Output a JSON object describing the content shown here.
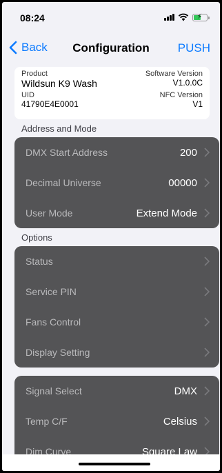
{
  "status_bar": {
    "time": "08:24"
  },
  "nav": {
    "back_label": "Back",
    "title": "Configuration",
    "push_label": "PUSH"
  },
  "info": {
    "product_label": "Product",
    "product_value": "Wildsun K9 Wash",
    "software_label": "Software Version",
    "software_value": "V1.0.0C",
    "uid_label": "UID",
    "uid_value": "41790E4E0001",
    "nfc_label": "NFC Version",
    "nfc_value": "V1"
  },
  "address_section": {
    "header": "Address and Mode",
    "rows": [
      {
        "label": "DMX Start Address",
        "value": "200"
      },
      {
        "label": "Decimal Universe",
        "value": "00000"
      },
      {
        "label": "User Mode",
        "value": "Extend Mode"
      }
    ]
  },
  "options_section": {
    "header": "Options",
    "rows": [
      {
        "label": "Status"
      },
      {
        "label": "Service PIN"
      },
      {
        "label": "Fans Control"
      },
      {
        "label": "Display Setting"
      }
    ]
  },
  "settings_section": {
    "rows": [
      {
        "label": "Signal Select",
        "value": "DMX"
      },
      {
        "label": "Temp C/F",
        "value": "Celsius"
      },
      {
        "label": "Dim Curve",
        "value": "Square Law"
      }
    ]
  },
  "colors": {
    "accent": "#0a7aff",
    "group_bg": "#545456",
    "page_bg": "#f2f2f7"
  }
}
